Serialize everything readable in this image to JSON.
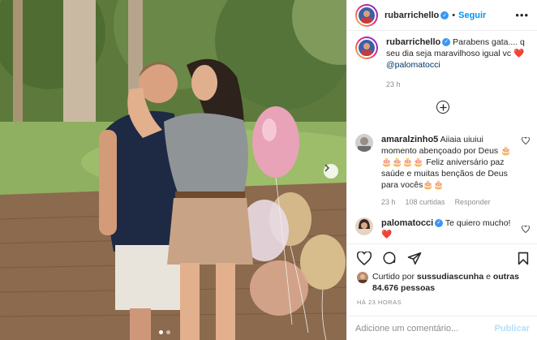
{
  "post": {
    "author": "rubarrichello",
    "follow_label": "Seguir",
    "separator": "•",
    "more_icon": "more-icon"
  },
  "caption": {
    "username": "rubarrichello",
    "text": "Parabens gata.... q seu dia seja maravilhoso igual vc ❤️",
    "mention": "@palomatocci",
    "time": "23 h"
  },
  "comments": [
    {
      "username": "amaralzinho5",
      "text": "Aiiaia uiuiui momento abençoado por Deus 🎂🎂🎂🎂🎂 Feliz aniversário paz saúde e muitas bençãos de Deus para vocês🎂🎂",
      "time": "23 h",
      "likes": "108 curtidas",
      "reply": "Responder"
    },
    {
      "username": "palomatocci",
      "text": "Te quiero mucho! ❤️",
      "time": "",
      "likes": "",
      "reply": ""
    }
  ],
  "likes": {
    "prefix": "Curtido por",
    "user": "sussudiascunha",
    "middle": "e",
    "others": "outras 84.676 pessoas"
  },
  "timestamp": "HÁ 23 HORAS",
  "add_comment": {
    "placeholder": "Adicione um comentário...",
    "post_label": "Publicar"
  },
  "carousel": {
    "slide_count": 2,
    "active_index": 0
  },
  "colors": {
    "link_blue": "#0095f6",
    "verified_blue": "#3897f0",
    "mention": "#00376b",
    "muted": "#8e8e8e",
    "heart_red": "#ed4956"
  }
}
